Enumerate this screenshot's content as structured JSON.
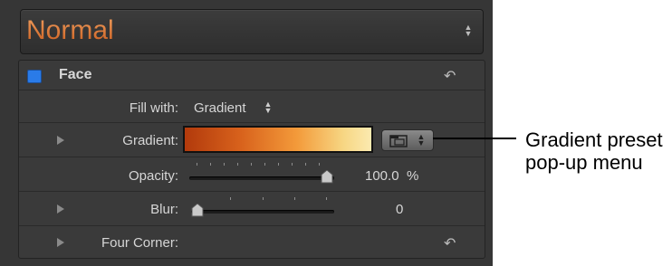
{
  "preset": {
    "value": "Normal"
  },
  "face": {
    "label": "Face",
    "enabled": true
  },
  "fill_with": {
    "label": "Fill with:",
    "value": "Gradient"
  },
  "gradient": {
    "label": "Gradient:"
  },
  "opacity": {
    "label": "Opacity:",
    "value": "100.0",
    "unit": "%",
    "level": 1.0
  },
  "blur": {
    "label": "Blur:",
    "value": "0",
    "level": 0.0
  },
  "four_corner": {
    "label": "Four Corner:"
  },
  "callout": {
    "line1": "Gradient preset",
    "line2": "pop-up menu"
  },
  "colors": {
    "panel": "#363636",
    "accent_text": "#e07a2e",
    "checkbox": "#2a7be8"
  }
}
